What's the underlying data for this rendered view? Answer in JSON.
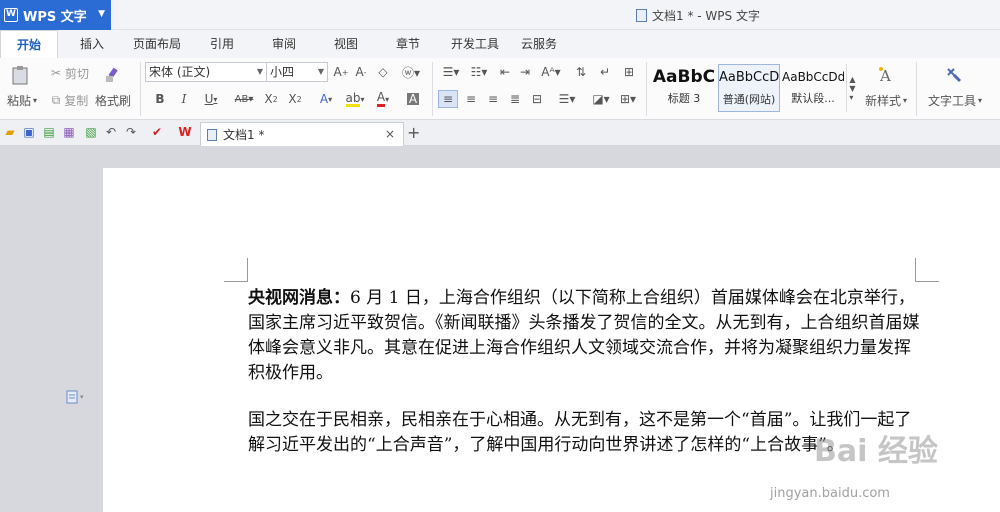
{
  "titlebar": {
    "app_name": "WPS 文字",
    "logo_glyph": "W",
    "window_title": "文档1 * - WPS 文字"
  },
  "tabs": [
    "开始",
    "插入",
    "页面布局",
    "引用",
    "审阅",
    "视图",
    "章节",
    "开发工具",
    "云服务"
  ],
  "ribbon": {
    "paste_label": "粘贴",
    "cut_label": "剪切",
    "copy_label": "复制",
    "format_painter_label": "格式刷",
    "font_name": "宋体 (正文)",
    "font_size": "小四",
    "styles": [
      {
        "sample": "AaBbC",
        "name": "标题 3"
      },
      {
        "sample": "AaBbCcD",
        "name": "普通(网站)"
      },
      {
        "sample": "AaBbCcDd",
        "name": "默认段..."
      }
    ],
    "new_style_label": "新样式",
    "text_tools_label": "文字工具"
  },
  "doc_tab": {
    "title": "文档1 *",
    "close": "×",
    "add": "+"
  },
  "document": {
    "p1_lead": "央视网消息：",
    "p1_body": "6 月 1 日，上海合作组织（以下简称上合组织）首届媒体峰会在北京举行，国家主席习近平致贺信。《新闻联播》头条播发了贺信的全文。从无到有，上合组织首届媒体峰会意义非凡。其意在促进上海合作组织人文领域交流合作，并将为凝聚组织力量发挥积极作用。",
    "p2": "国之交在于民相亲，民相亲在于心相通。从无到有，这不是第一个“首届”。让我们一起了解习近平发出的“上合声音”，了解中国用行动向世界讲述了怎样的“上合故事”。"
  },
  "watermark": {
    "text": "Bai 经验",
    "url": "jingyan.baidu.com"
  },
  "colors": {
    "accent": "#2b6cd4",
    "active_tab": "#1f5fbf"
  }
}
